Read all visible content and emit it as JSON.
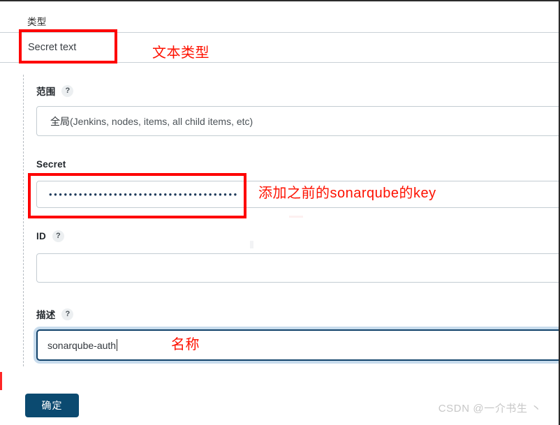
{
  "form": {
    "type": {
      "label": "类型",
      "selected_value": "Secret text"
    },
    "scope": {
      "label": "范围",
      "help_icon": "?",
      "value_cn": "全局",
      "value_en": " (Jenkins, nodes, items, all child items, etc)"
    },
    "secret": {
      "label": "Secret",
      "masked_value": "••••••••••••••••••••••••••••••••••••••"
    },
    "id": {
      "label": "ID",
      "help_icon": "?",
      "value": ""
    },
    "description": {
      "label": "描述",
      "help_icon": "?",
      "value": "sonarqube-auth"
    },
    "submit_label": "确定"
  },
  "annotations": [
    {
      "id": "type",
      "text": "文本类型"
    },
    {
      "id": "secret",
      "text": "添加之前的sonarqube的key"
    },
    {
      "id": "name",
      "text": "名称"
    }
  ],
  "annotation_texts": {
    "type": "文本类型",
    "secret": "添加之前的sonarqube的key",
    "name": "名称"
  },
  "watermark": "CSDN @一介书生 丶",
  "colors": {
    "annotation_red": "#fe0000",
    "submit_blue": "#0b4a70",
    "focus_border": "#12436b",
    "focus_halo": "#c8dced",
    "input_border": "#c3ccd2",
    "watermark_gray": "#c7c7c7"
  }
}
